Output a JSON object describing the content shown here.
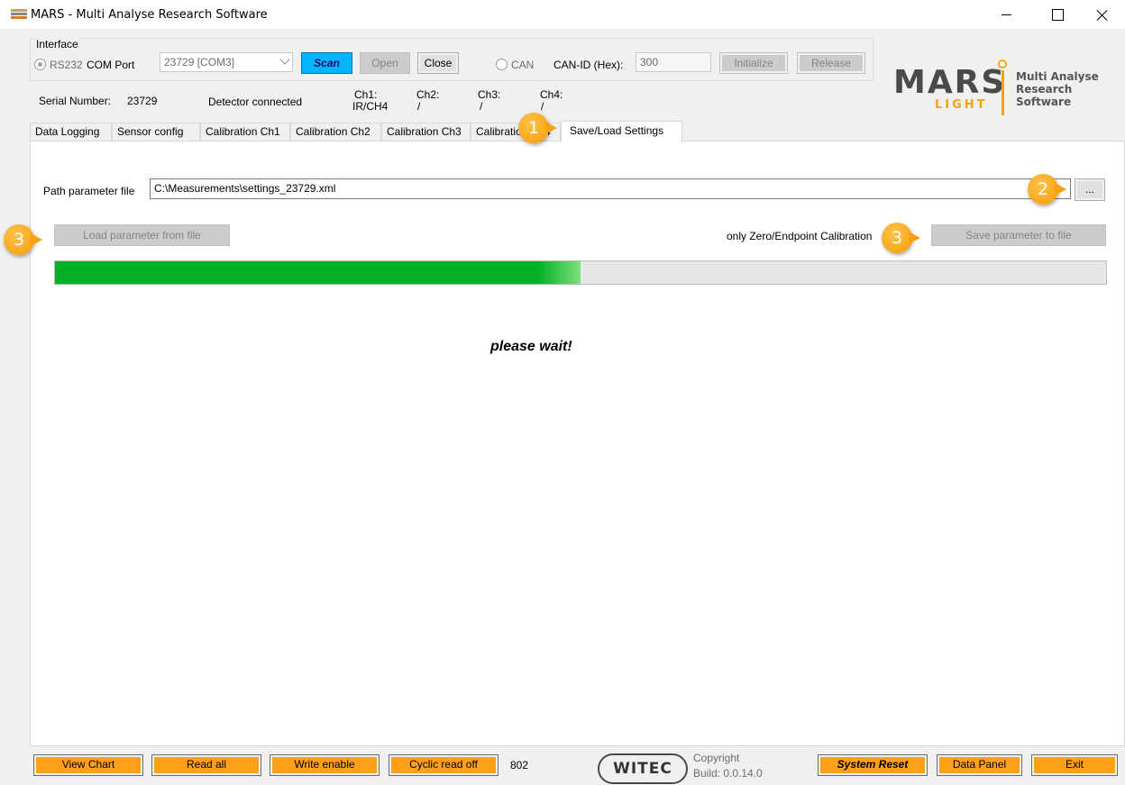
{
  "window": {
    "title": "MARS - Multi Analyse Research Software"
  },
  "interface": {
    "group_label": "Interface",
    "rs232_label": "RS232",
    "com_port_label": "COM Port",
    "com_port_value": "23729 [COM3]",
    "scan_label": "Scan",
    "open_label": "Open",
    "close_label": "Close",
    "can_label": "CAN",
    "can_id_label": "CAN-ID (Hex):",
    "can_id_value": "300",
    "initialize_label": "Initialize",
    "release_label": "Release"
  },
  "status": {
    "serial_label": "Serial Number:",
    "serial_value": "23729",
    "detector_status": "Detector connected",
    "ch1_label": "Ch1:",
    "ch1_value": "IR/CH4",
    "ch2_label": "Ch2:",
    "ch2_value": "/",
    "ch3_label": "Ch3:",
    "ch3_value": "/",
    "ch4_label": "Ch4:",
    "ch4_value": "/"
  },
  "logo": {
    "word": "MARS",
    "sub_word": "LIGHT",
    "tagline_1": "Multi Analyse",
    "tagline_2": "Research Software"
  },
  "tabs": [
    {
      "label": "Data Logging"
    },
    {
      "label": "Sensor config"
    },
    {
      "label": "Calibration Ch1"
    },
    {
      "label": "Calibration Ch2"
    },
    {
      "label": "Calibration Ch3"
    },
    {
      "label": "Calibration Ch4"
    },
    {
      "label": "Save/Load Settings",
      "active": true
    }
  ],
  "settings": {
    "path_label": "Path parameter file",
    "path_value": "C:\\Measurements\\settings_23729.xml",
    "browse_label": "...",
    "load_label": "Load parameter from file",
    "zero_endpoint_label": "only Zero/Endpoint Calibration",
    "save_label": "Save parameter to file",
    "progress": 0.5,
    "wait_text": "please wait!"
  },
  "bottom": {
    "view_chart": "View Chart",
    "read_all": "Read all",
    "write_enable": "Write enable",
    "cyclic_read": "Cyclic read off",
    "counter": "802",
    "brand": "WITEC",
    "copyright": "Copyright",
    "build": "Build: 0.0.14.0",
    "system_reset": "System Reset",
    "data_panel": "Data Panel",
    "exit": "Exit"
  },
  "callouts": [
    "1",
    "2",
    "3",
    "3"
  ],
  "colors": {
    "orange_button": "#ff9f1a",
    "progress_fill": "#06b025",
    "scan_button": "#00b4ff",
    "callout": "#f79a06"
  }
}
